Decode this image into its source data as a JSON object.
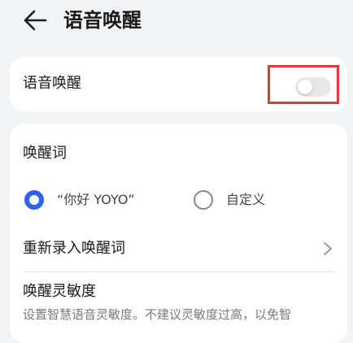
{
  "header": {
    "back_icon": "arrow-left-icon",
    "title": "语音唤醒"
  },
  "voice_wake": {
    "label": "语音唤醒",
    "toggle_on": false
  },
  "wake_word": {
    "section_title": "唤醒词",
    "options": [
      {
        "label": "“你好 YOYO”",
        "selected": true
      },
      {
        "label": "自定义",
        "selected": false
      }
    ],
    "rerecord_label": "重新录入唤醒词",
    "chevron_icon": "chevron-right-icon"
  },
  "sensitivity": {
    "title": "唤醒灵敏度",
    "description": "设置智慧语音灵敏度。不建议灵敏度过高，以免智"
  },
  "colors": {
    "accent": "#2f63e6",
    "highlight_box": "#e53935",
    "background": "#f1f3f5"
  }
}
